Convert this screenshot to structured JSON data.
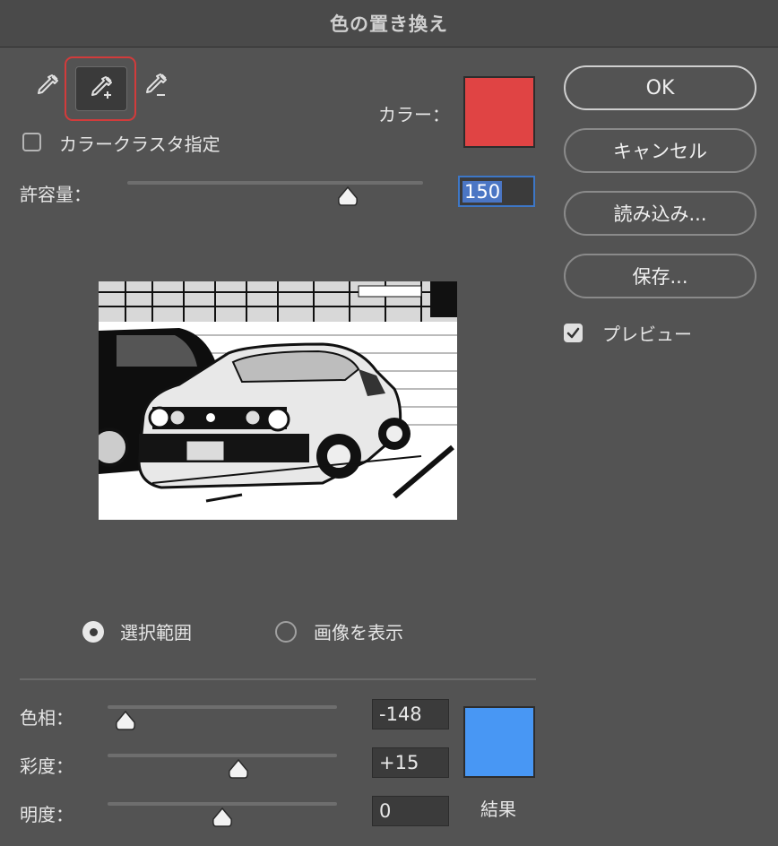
{
  "window": {
    "title": "色の置き換え"
  },
  "tools": {
    "eyedropper": "eyedropper-icon",
    "eyedropper_add": "eyedropper-plus-icon",
    "eyedropper_subtract": "eyedropper-minus-icon"
  },
  "color": {
    "label": "カラー：",
    "swatch_hex": "#e04444"
  },
  "color_cluster": {
    "label": "カラークラスタ指定",
    "checked": false
  },
  "fuzziness": {
    "label": "許容量：",
    "value": "150"
  },
  "view_mode": {
    "selection_label": "選択範囲",
    "image_label": "画像を表示",
    "selected": "selection"
  },
  "replacement": {
    "hue": {
      "label": "色相：",
      "value": "-148"
    },
    "saturation": {
      "label": "彩度：",
      "value": "+15"
    },
    "lightness": {
      "label": "明度：",
      "value": "0"
    },
    "result_label": "結果",
    "result_hex": "#4897f4"
  },
  "buttons": {
    "ok": "OK",
    "cancel": "キャンセル",
    "load": "読み込み...",
    "save": "保存..."
  },
  "preview_option": {
    "label": "プレビュー",
    "checked": true
  }
}
